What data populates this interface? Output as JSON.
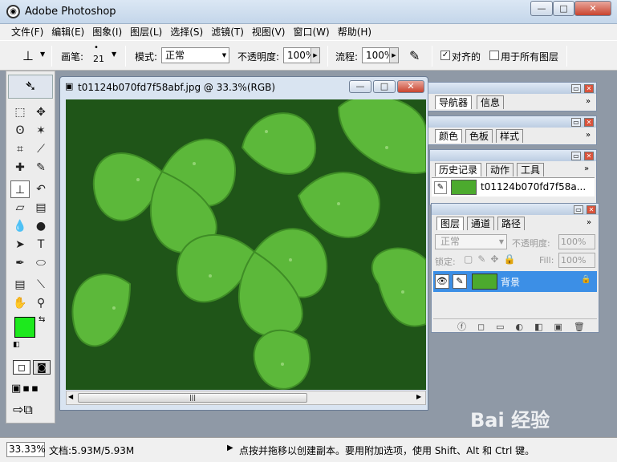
{
  "window": {
    "title": "Adobe Photoshop",
    "logo_icon": "photoshop-eye-icon",
    "buttons": {
      "minimize": "—",
      "maximize": "□",
      "close": "✕"
    }
  },
  "menu": [
    "文件(F)",
    "编辑(E)",
    "图象(I)",
    "图层(L)",
    "选择(S)",
    "滤镜(T)",
    "视图(V)",
    "窗口(W)",
    "帮助(H)"
  ],
  "options": {
    "brush_label": "画笔:",
    "brush_size": "21",
    "mode_label": "模式:",
    "mode_value": "正常",
    "opacity_label": "不透明度:",
    "opacity_value": "100%",
    "flow_label": "流程:",
    "flow_value": "100%",
    "aligned_label": "对齐的",
    "aligned_checked": true,
    "all_layers_label": "用于所有图层",
    "all_layers_checked": false
  },
  "toolbox": {
    "tools": [
      "marquee-icon",
      "move-icon",
      "lasso-icon",
      "magic-wand-icon",
      "crop-icon",
      "slice-icon",
      "healing-brush-icon",
      "brush-icon",
      "clone-stamp-icon",
      "history-brush-icon",
      "eraser-icon",
      "gradient-icon",
      "blur-icon",
      "dodge-icon",
      "path-select-icon",
      "type-icon",
      "pen-icon",
      "shape-icon",
      "notes-icon",
      "eyedropper-icon",
      "hand-icon",
      "zoom-icon"
    ],
    "foreground_color": "#1de91d",
    "background_color": "#ffffff"
  },
  "document": {
    "title": "t01124b070fd7f58abf.jpg @ 33.3%(RGB)",
    "image_subject": "clover-leaves-image"
  },
  "panels": {
    "navigator": {
      "tabs": [
        "导航器",
        "信息"
      ]
    },
    "color": {
      "tabs": [
        "颜色",
        "色板",
        "样式"
      ]
    },
    "history": {
      "tabs": [
        "历史记录",
        "动作",
        "工具"
      ],
      "item": "t01124b070fd7f58a..."
    },
    "layers": {
      "tabs": [
        "图层",
        "通道",
        "路径"
      ],
      "blend_mode": "正常",
      "opacity_label": "不透明度:",
      "opacity_value": "100%",
      "lock_label": "锁定:",
      "fill_label": "Fill:",
      "fill_value": "100%",
      "layer_name": "背景"
    }
  },
  "status": {
    "zoom": "33.33%",
    "doc_size": "文档:5.93M/5.93M",
    "hint": "点按并拖移以创建副本。要用附加选项，使用 Shift、Alt 和 Ctrl 键。"
  },
  "watermark": "Bai 经验",
  "colors": {
    "selected_layer": "#3c8fe6",
    "accent_green": "#4caa2e"
  }
}
